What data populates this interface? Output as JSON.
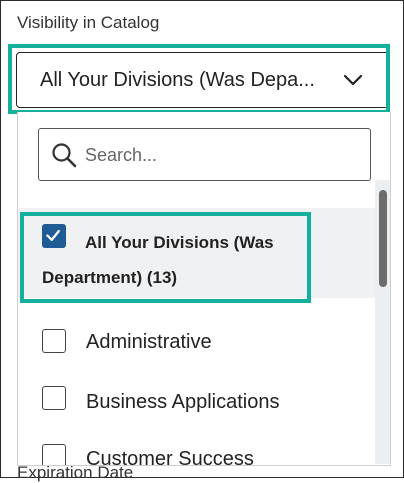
{
  "field": {
    "label": "Visibility in Catalog",
    "selected_value": "All Your Divisions (Was Depa...",
    "expand_icon": "chevron-down-icon"
  },
  "search": {
    "placeholder": "Search...",
    "value": "",
    "icon": "search-icon"
  },
  "options": [
    {
      "label": "All Your Divisions (Was Department) (13)",
      "checked": true
    },
    {
      "label": "Administrative",
      "checked": false
    },
    {
      "label": "Business Applications",
      "checked": false
    },
    {
      "label": "Customer Success",
      "checked": false
    }
  ],
  "next_field_label": "Expiration Date",
  "colors": {
    "highlight_outline": "#13b09c",
    "checkbox_checked": "#1f5c96",
    "selected_row_bg": "#f0f1f3"
  }
}
